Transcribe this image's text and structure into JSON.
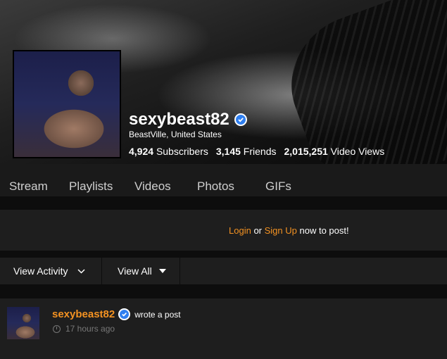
{
  "profile": {
    "name": "sexybeast82",
    "location": "BeastVille, United States",
    "subscribers_count": "4,924",
    "subscribers_label": "Subscribers",
    "friends_count": "3,145",
    "friends_label": "Friends",
    "views_count": "2,015,251",
    "views_label": "Video Views"
  },
  "tabs": [
    "Stream",
    "Playlists",
    "Videos",
    "Photos",
    "GIFs"
  ],
  "post_prompt": {
    "login": "Login",
    "or": "or",
    "signup": "Sign Up",
    "suffix": "now to post!"
  },
  "filters": {
    "activity": "View Activity",
    "all": "View All"
  },
  "feed": {
    "user": "sexybeast82",
    "action": "wrote a post",
    "time": "17 hours ago"
  },
  "colors": {
    "accent": "#f39222",
    "verified": "#2f7ff0"
  }
}
